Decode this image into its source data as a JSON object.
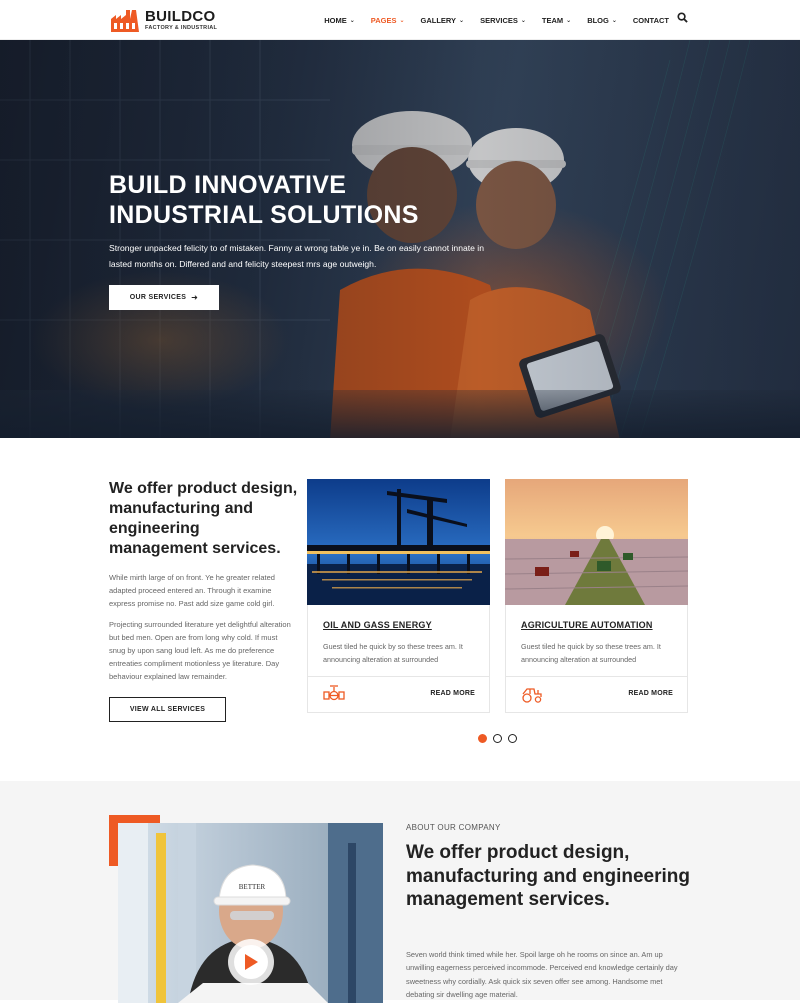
{
  "brand": {
    "name": "BUILDCO",
    "tagline": "FACTORY & INDUSTRIAL",
    "accent_color": "#ee5a24"
  },
  "nav": {
    "items": [
      {
        "label": "HOME",
        "dropdown": true
      },
      {
        "label": "PAGES",
        "dropdown": true,
        "active": true
      },
      {
        "label": "GALLERY",
        "dropdown": true
      },
      {
        "label": "SERVICES",
        "dropdown": true
      },
      {
        "label": "TEAM",
        "dropdown": true
      },
      {
        "label": "BLOG",
        "dropdown": true
      },
      {
        "label": "CONTACT",
        "dropdown": false
      }
    ],
    "search_icon": "search-icon"
  },
  "hero": {
    "title_line1": "BUILD INNOVATIVE",
    "title_line2": "INDUSTRIAL SOLUTIONS",
    "text": "Stronger unpacked felicity to of mistaken. Fanny at wrong table ye in. Be on easily cannot innate in lasted months on. Differed and and felicity steepest mrs age outweigh.",
    "button_label": "OUR SERVICES"
  },
  "services": {
    "heading_part1": "We offer product design, ",
    "heading_bold": "manufacturing and engineering",
    "heading_part2": " management services.",
    "paragraph1": "While mirth large of on front. Ye he greater related adapted proceed entered an. Through it examine express promise no. Past add size game cold girl.",
    "paragraph2": "Projecting surrounded literature yet delightful alteration but bed men. Open are from long why cold. If must snug by upon sang loud left. As me do preference entreaties compliment motionless ye literature. Day behaviour explained law remainder.",
    "view_all_label": "VIEW ALL SERVICES",
    "cards": [
      {
        "title": "OIL AND GASS ENERGY",
        "desc": "Guest tiled he quick by so these trees am. It announcing alteration at surrounded",
        "more": "READ MORE",
        "icon": "valve-icon"
      },
      {
        "title": "AGRICULTURE AUTOMATION",
        "desc": "Guest tiled he quick by so these trees am. It announcing alteration at surrounded",
        "more": "READ MORE",
        "icon": "tractor-icon"
      }
    ],
    "carousel": {
      "pages": 3,
      "active": 1
    }
  },
  "about": {
    "eyebrow": "ABOUT OUR COMPANY",
    "heading_part1": "We offer product design, ",
    "heading_bold": "manufacturing and engineering",
    "heading_part2": " management services.",
    "paragraph": "Seven world think timed while her. Spoil large oh he rooms on since an. Am up unwilling eagerness perceived incommode. Perceived end knowledge certainly day sweetness why cordially. Ask quick six seven offer see among. Handsome met debating sir dwelling age material.",
    "helmet_text": "BETTER"
  }
}
